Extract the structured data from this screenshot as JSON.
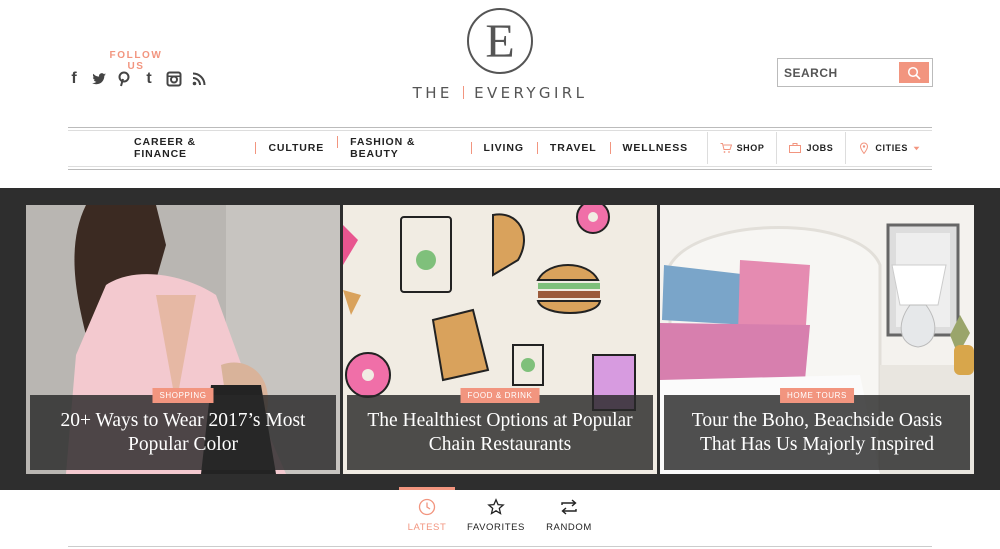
{
  "header": {
    "follow_label": "FOLLOW US",
    "social_icons": [
      "facebook-icon",
      "twitter-icon",
      "pinterest-icon",
      "tumblr-icon",
      "instagram-icon",
      "rss-icon"
    ],
    "logo_letter": "E",
    "logo_word_left": "THE",
    "logo_word_right": "EVERYGIRL",
    "search_placeholder": "SEARCH"
  },
  "nav": {
    "items": [
      "CAREER & FINANCE",
      "CULTURE",
      "FASHION & BEAUTY",
      "LIVING",
      "TRAVEL",
      "WELLNESS"
    ],
    "shop": "SHOP",
    "jobs": "JOBS",
    "cities": "CITIES"
  },
  "hero": {
    "cards": [
      {
        "tag": "SHOPPING",
        "title": "20+ Ways to Wear 2017’s Most Popular Color"
      },
      {
        "tag": "FOOD & DRINK",
        "title": "The Healthiest Options at Popular Chain Restaurants"
      },
      {
        "tag": "HOME TOURS",
        "title": "Tour the Boho, Beachside Oasis That Has Us Majorly Inspired"
      }
    ]
  },
  "tabs": {
    "latest": "LATEST",
    "favorites": "FAVORITES",
    "random": "RANDOM"
  },
  "colors": {
    "accent": "#f2957f",
    "hero_bg": "#2e2e2e",
    "text": "#222222"
  }
}
